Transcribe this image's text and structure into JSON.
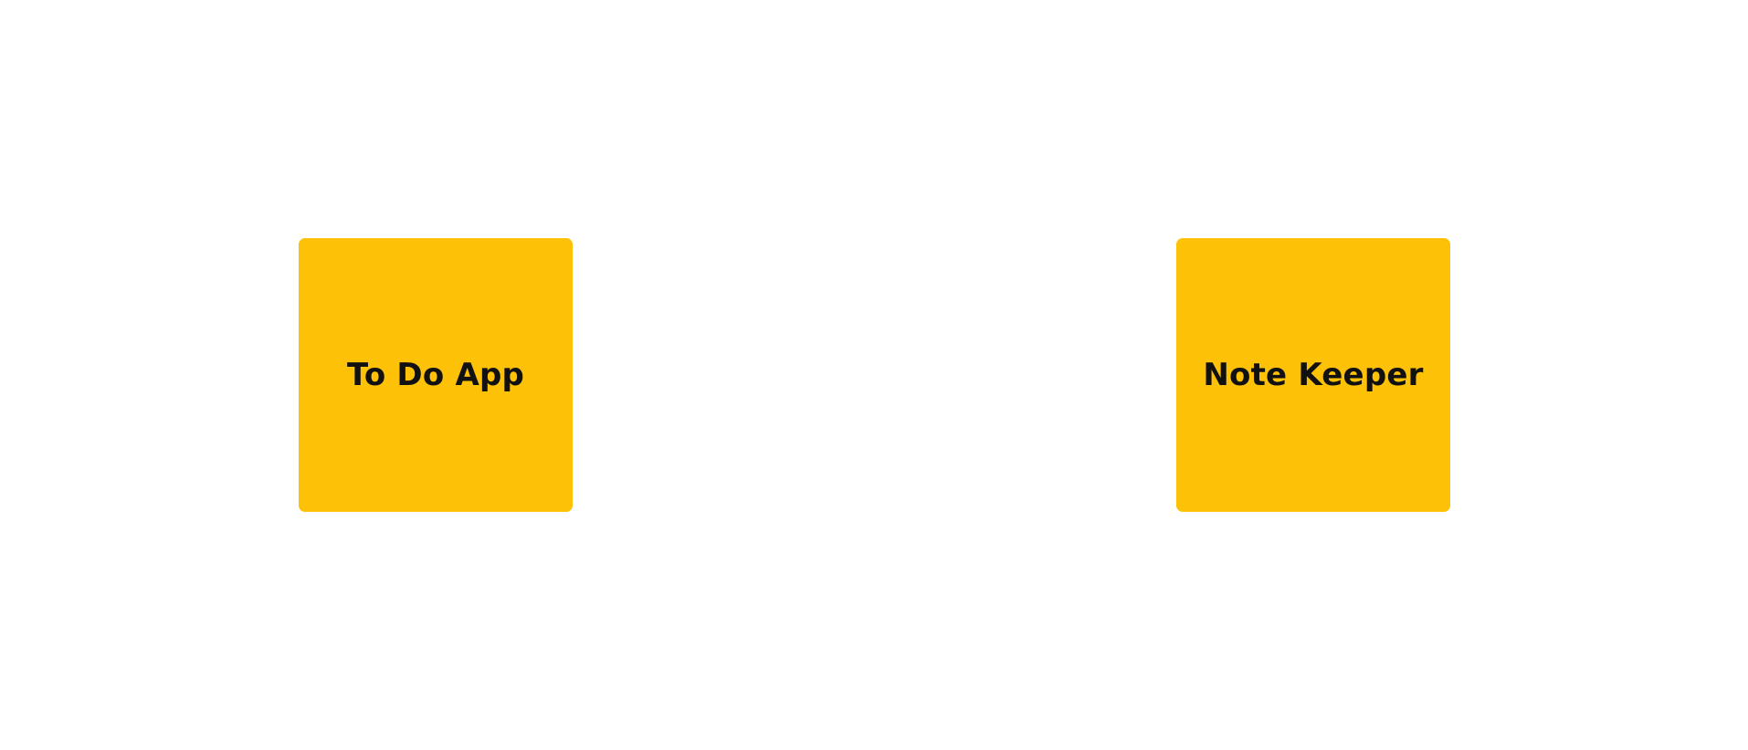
{
  "apps": [
    {
      "label": "To Do App"
    },
    {
      "label": "Note Keeper"
    }
  ],
  "colors": {
    "background": "#ffffff",
    "tile": "#fdc107",
    "tile_text": "#111111"
  }
}
